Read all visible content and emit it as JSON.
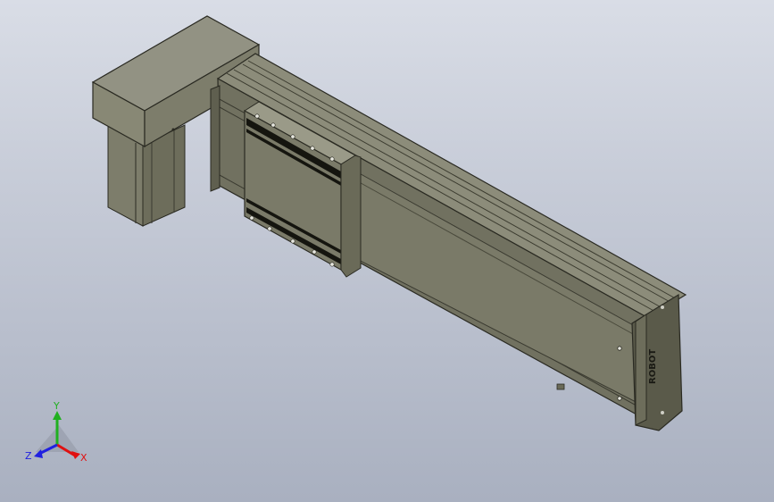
{
  "model": {
    "logo_text": "ROBOT"
  },
  "triad": {
    "x_label": "X",
    "y_label": "Y",
    "z_label": "Z",
    "x_color": "#e01010",
    "y_color": "#20b020",
    "z_color": "#2020e0"
  },
  "colors": {
    "body_light": "#8a8a78",
    "body_mid": "#73735f",
    "body_dark": "#4a4a3c",
    "slot_black": "#15150f",
    "edge": "#2a2a22"
  }
}
